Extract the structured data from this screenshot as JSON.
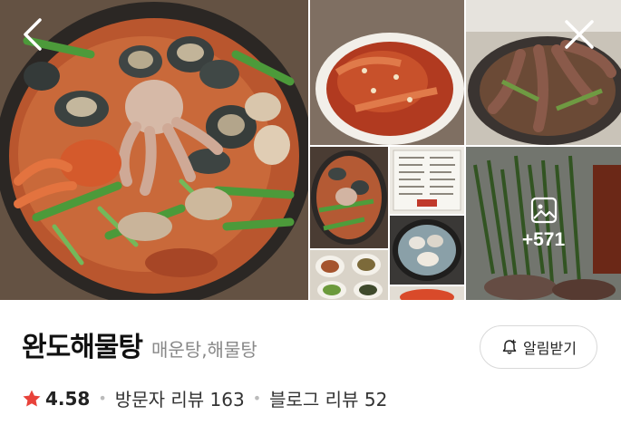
{
  "gallery": {
    "more_count": "+571",
    "back_icon": "chevron-left-icon",
    "close_icon": "close-icon",
    "more_icon": "image-icon"
  },
  "place": {
    "name": "완도해물탕",
    "category": "매운탕,해물탕"
  },
  "alarm_button": {
    "label": "알림받기",
    "icon": "bell-plus-icon"
  },
  "stats": {
    "rating": "4.58",
    "visitor_reviews": "방문자 리뷰 163",
    "blog_reviews": "블로그 리뷰 52"
  },
  "colors": {
    "star": "#e8423a",
    "title": "#111111",
    "muted": "#888888"
  }
}
